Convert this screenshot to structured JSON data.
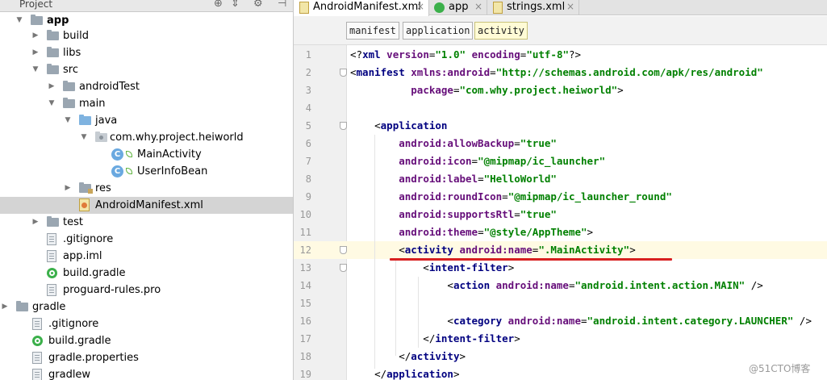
{
  "project_panel": {
    "title": "Project",
    "header_icons": [
      "globe-icon",
      "collapse-icon",
      "gear-icon",
      "hide-icon"
    ],
    "tree": [
      {
        "label": "app",
        "icon": "module-folder-icon",
        "bold": true
      },
      {
        "label": "build",
        "icon": "folder-icon"
      },
      {
        "label": "libs",
        "icon": "folder-icon"
      },
      {
        "label": "src",
        "icon": "folder-icon"
      },
      {
        "label": "androidTest",
        "icon": "folder-icon"
      },
      {
        "label": "main",
        "icon": "folder-icon"
      },
      {
        "label": "java",
        "icon": "source-folder-icon"
      },
      {
        "label": "com.why.project.heiworld",
        "icon": "package-icon"
      },
      {
        "label": "MainActivity",
        "icon": "class-icon"
      },
      {
        "label": "UserInfoBean",
        "icon": "class-icon"
      },
      {
        "label": "res",
        "icon": "resource-folder-icon"
      },
      {
        "label": "AndroidManifest.xml",
        "icon": "xml-file-icon",
        "selected": true
      },
      {
        "label": "test",
        "icon": "folder-icon"
      },
      {
        "label": ".gitignore",
        "icon": "text-file-icon"
      },
      {
        "label": "app.iml",
        "icon": "text-file-icon"
      },
      {
        "label": "build.gradle",
        "icon": "gradle-icon"
      },
      {
        "label": "proguard-rules.pro",
        "icon": "text-file-icon"
      },
      {
        "label": "gradle",
        "icon": "folder-icon"
      },
      {
        "label": ".gitignore",
        "icon": "text-file-icon"
      },
      {
        "label": "build.gradle",
        "icon": "gradle-icon"
      },
      {
        "label": "gradle.properties",
        "icon": "text-file-icon"
      },
      {
        "label": "gradlew",
        "icon": "text-file-icon"
      }
    ]
  },
  "editor": {
    "tabs": [
      {
        "label": "AndroidManifest.xml",
        "icon": "xml-file-icon",
        "active": true
      },
      {
        "label": "app",
        "icon": "module-icon"
      },
      {
        "label": "strings.xml",
        "icon": "xml-file-icon"
      }
    ],
    "breadcrumbs": [
      "manifest",
      "application",
      "activity"
    ],
    "lines": [
      {
        "n": "1",
        "t": [
          [
            "pu",
            "<?"
          ],
          [
            "tg",
            "xml "
          ],
          [
            "at",
            "version"
          ],
          [
            "pu",
            "="
          ],
          [
            "av",
            "\"1.0\""
          ],
          [
            "pu",
            " "
          ],
          [
            "at",
            "encoding"
          ],
          [
            "pu",
            "="
          ],
          [
            "av",
            "\"utf-8\""
          ],
          [
            "pu",
            "?>"
          ]
        ]
      },
      {
        "n": "2",
        "t": [
          [
            "pu",
            "<"
          ],
          [
            "tg",
            "manifest "
          ],
          [
            "at",
            "xmlns:android"
          ],
          [
            "pu",
            "="
          ],
          [
            "av",
            "\"http://schemas.android.com/apk/res/android\""
          ]
        ]
      },
      {
        "n": "3",
        "t": [
          [
            "pu",
            "          "
          ],
          [
            "at",
            "package"
          ],
          [
            "pu",
            "="
          ],
          [
            "av",
            "\"com.why.project.heiworld\""
          ],
          [
            "pu",
            ">"
          ]
        ]
      },
      {
        "n": "4",
        "t": []
      },
      {
        "n": "5",
        "t": [
          [
            "pu",
            "    <"
          ],
          [
            "tg",
            "application"
          ]
        ]
      },
      {
        "n": "6",
        "t": [
          [
            "pu",
            "        "
          ],
          [
            "at",
            "android:allowBackup"
          ],
          [
            "pu",
            "="
          ],
          [
            "av",
            "\"true\""
          ]
        ]
      },
      {
        "n": "7",
        "t": [
          [
            "pu",
            "        "
          ],
          [
            "at",
            "android:icon"
          ],
          [
            "pu",
            "="
          ],
          [
            "av",
            "\"@mipmap/ic_launcher\""
          ]
        ]
      },
      {
        "n": "8",
        "t": [
          [
            "pu",
            "        "
          ],
          [
            "at",
            "android:label"
          ],
          [
            "pu",
            "="
          ],
          [
            "av",
            "\"HelloWorld\""
          ]
        ]
      },
      {
        "n": "9",
        "t": [
          [
            "pu",
            "        "
          ],
          [
            "at",
            "android:roundIcon"
          ],
          [
            "pu",
            "="
          ],
          [
            "av",
            "\"@mipmap/ic_launcher_round\""
          ]
        ]
      },
      {
        "n": "10",
        "t": [
          [
            "pu",
            "        "
          ],
          [
            "at",
            "android:supportsRtl"
          ],
          [
            "pu",
            "="
          ],
          [
            "av",
            "\"true\""
          ]
        ]
      },
      {
        "n": "11",
        "t": [
          [
            "pu",
            "        "
          ],
          [
            "at",
            "android:theme"
          ],
          [
            "pu",
            "="
          ],
          [
            "av",
            "\"@style/AppTheme\""
          ],
          [
            "pu",
            ">"
          ]
        ]
      },
      {
        "n": "12",
        "t": [
          [
            "pu",
            "        <"
          ],
          [
            "tg",
            "activity "
          ],
          [
            "at",
            "android:name"
          ],
          [
            "pu",
            "="
          ],
          [
            "av",
            "\".MainActivity\""
          ],
          [
            "pu",
            ">"
          ]
        ]
      },
      {
        "n": "13",
        "t": [
          [
            "pu",
            "            <"
          ],
          [
            "tg",
            "intent-filter"
          ],
          [
            "pu",
            ">"
          ]
        ]
      },
      {
        "n": "14",
        "t": [
          [
            "pu",
            "                <"
          ],
          [
            "tg",
            "action "
          ],
          [
            "at",
            "android:name"
          ],
          [
            "pu",
            "="
          ],
          [
            "av",
            "\"android.intent.action.MAIN\""
          ],
          [
            "pu",
            " />"
          ]
        ]
      },
      {
        "n": "15",
        "t": []
      },
      {
        "n": "16",
        "t": [
          [
            "pu",
            "                <"
          ],
          [
            "tg",
            "category "
          ],
          [
            "at",
            "android:name"
          ],
          [
            "pu",
            "="
          ],
          [
            "av",
            "\"android.intent.category.LAUNCHER\""
          ],
          [
            "pu",
            " />"
          ]
        ]
      },
      {
        "n": "17",
        "t": [
          [
            "pu",
            "            </"
          ],
          [
            "tg",
            "intent-filter"
          ],
          [
            "pu",
            ">"
          ]
        ]
      },
      {
        "n": "18",
        "t": [
          [
            "pu",
            "        </"
          ],
          [
            "tg",
            "activity"
          ],
          [
            "pu",
            ">"
          ]
        ]
      },
      {
        "n": "19",
        "t": [
          [
            "pu",
            "    </"
          ],
          [
            "tg",
            "application"
          ],
          [
            "pu",
            ">"
          ]
        ]
      }
    ]
  },
  "watermark": "@51CTO博客",
  "colors": {
    "tag": "#000080",
    "attribute": "#660e7a",
    "value": "#008000",
    "underline": "#d82020",
    "selection": "#d4d4d4"
  }
}
